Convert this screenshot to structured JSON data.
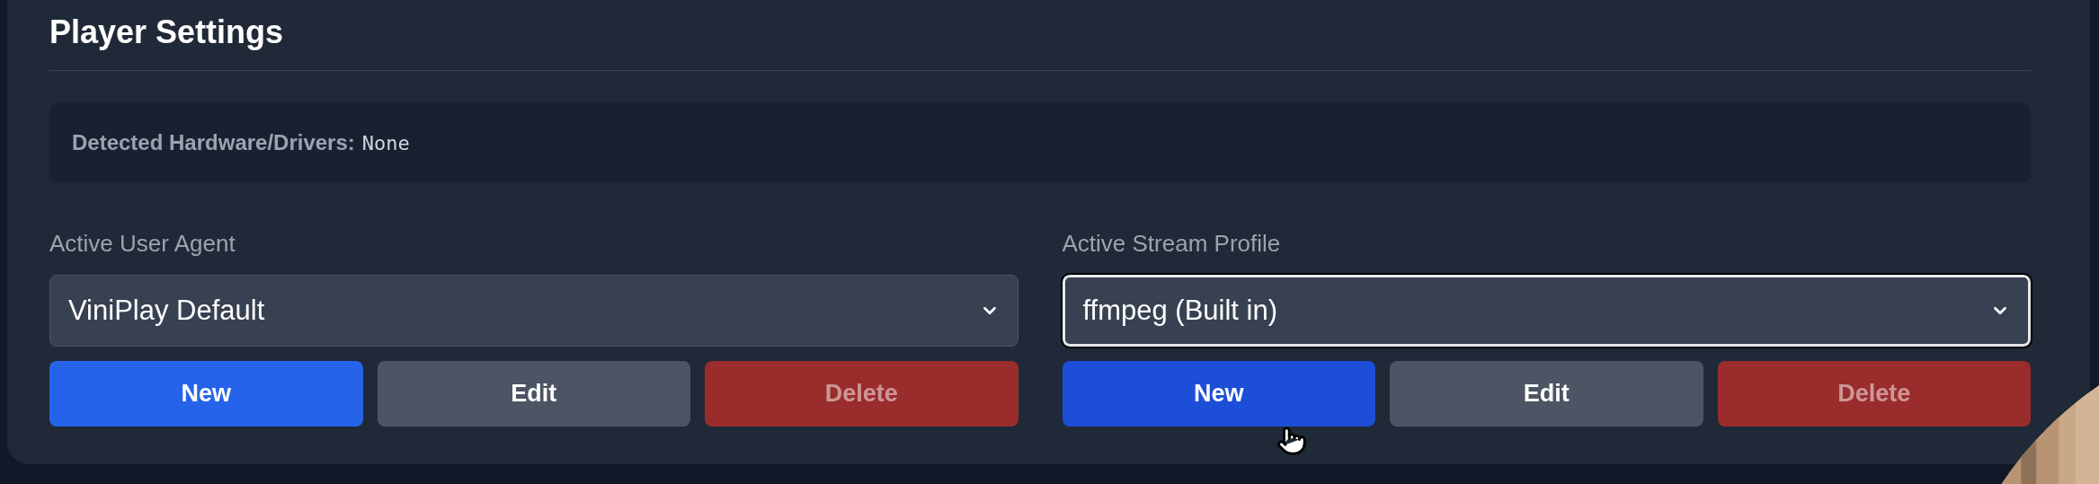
{
  "title": "Player Settings",
  "hardware": {
    "label": "Detected Hardware/Drivers:",
    "value": "None"
  },
  "selectors": [
    {
      "label": "Active User Agent",
      "value": "ViniPlay Default",
      "focused": false,
      "buttons": [
        {
          "kind": "new",
          "label": "New",
          "hovered": false,
          "disabled": false
        },
        {
          "kind": "edit",
          "label": "Edit",
          "hovered": false,
          "disabled": false
        },
        {
          "kind": "delete",
          "label": "Delete",
          "hovered": false,
          "disabled": true
        }
      ]
    },
    {
      "label": "Active Stream Profile",
      "value": "ffmpeg (Built in)",
      "focused": true,
      "buttons": [
        {
          "kind": "new",
          "label": "New",
          "hovered": true,
          "disabled": false
        },
        {
          "kind": "edit",
          "label": "Edit",
          "hovered": false,
          "disabled": false
        },
        {
          "kind": "delete",
          "label": "Delete",
          "hovered": false,
          "disabled": true
        }
      ]
    }
  ]
}
